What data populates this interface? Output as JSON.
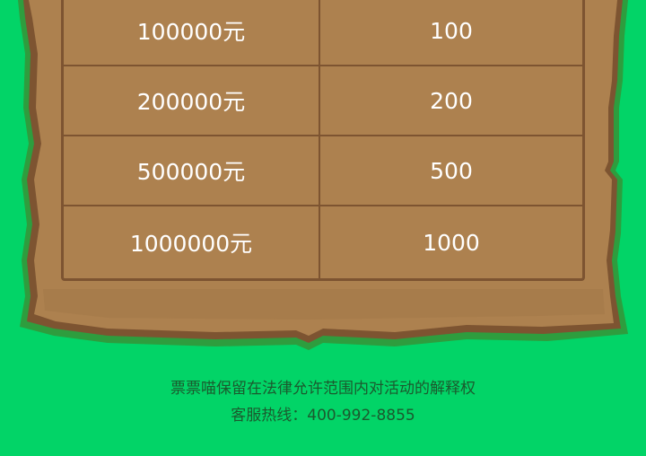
{
  "rows": [
    {
      "amount": "100000元",
      "value": "100"
    },
    {
      "amount": "200000元",
      "value": "200"
    },
    {
      "amount": "500000元",
      "value": "500"
    },
    {
      "amount": "1000000元",
      "value": "1000"
    }
  ],
  "footer": {
    "disclaimer": "票票喵保留在法律允许范围内对活动的解释权",
    "hotline": "客服热线：400-992-8855"
  },
  "colors": {
    "background": "#02d467",
    "board": "#ad814f",
    "board_border": "#7d5431",
    "board_shadow": "#2e9d3e",
    "footer_text": "#1b5a2e"
  }
}
